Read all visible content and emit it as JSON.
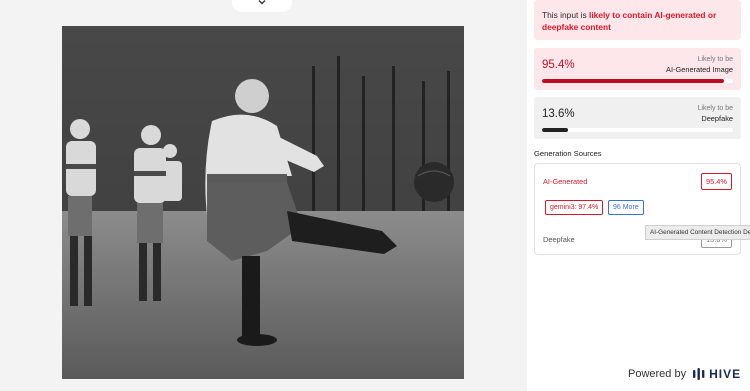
{
  "alert": {
    "prefix": "This input is ",
    "highlight": "likely to contain AI-generated or deepfake content"
  },
  "scores": {
    "ai_generated": {
      "percent_label": "95.4%",
      "value": 0.954,
      "label_top": "Likely to be",
      "label_main": "AI-Generated Image",
      "color": "#bb0d22"
    },
    "deepfake": {
      "percent_label": "13.6%",
      "value": 0.136,
      "label_top": "Likely to be",
      "label_main": "Deepfake",
      "color": "#222222"
    }
  },
  "generation_sources": {
    "title": "Generation Sources",
    "ai_generated": {
      "name": "AI-Generated",
      "badge": "95.4%",
      "model_chip": "gemini3: 97.4%",
      "more_chip": "96 More"
    },
    "deepfake": {
      "name": "Deepfake",
      "badge": "13.6%"
    }
  },
  "tooltip": "AI-Generated Content Detection Demo",
  "footer": {
    "powered_by": "Powered by",
    "brand": "HIVE"
  },
  "icons": {
    "collapse": "chevron-down-icon",
    "brand_logo": "hive-logo-icon"
  }
}
